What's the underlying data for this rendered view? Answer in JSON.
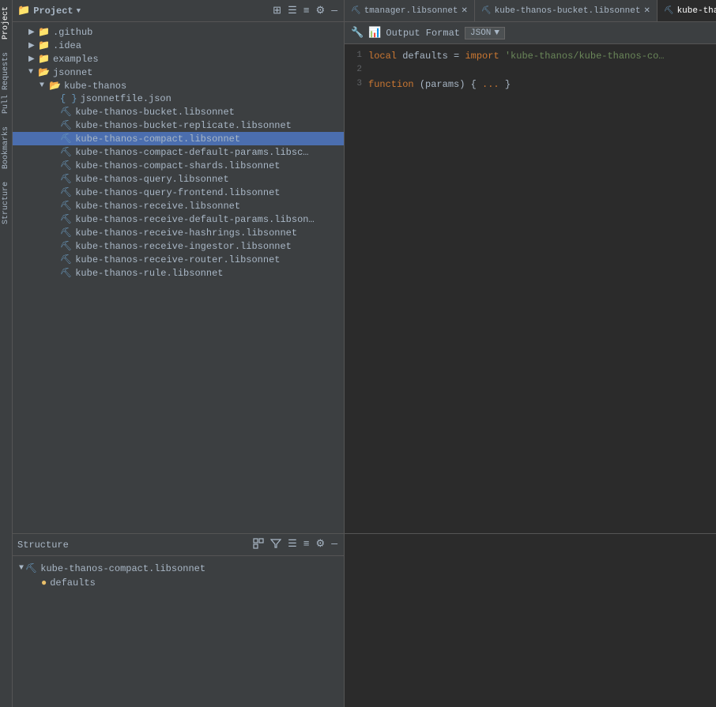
{
  "leftSidebar": {
    "tabs": [
      {
        "label": "Project",
        "active": true
      },
      {
        "label": "Pull Requests",
        "active": false
      },
      {
        "label": "Bookmarks",
        "active": false
      },
      {
        "label": "Structure",
        "active": false
      }
    ]
  },
  "projectPanel": {
    "title": "Project",
    "toolbar": {
      "icons": [
        "⊞",
        "☰",
        "≡",
        "⚙",
        "—"
      ]
    },
    "tree": [
      {
        "id": "github",
        "label": ".github",
        "indent": 1,
        "type": "folder",
        "arrow": "▶",
        "expanded": false
      },
      {
        "id": "idea",
        "label": ".idea",
        "indent": 1,
        "type": "folder",
        "arrow": "▶",
        "expanded": false
      },
      {
        "id": "examples",
        "label": "examples",
        "indent": 1,
        "type": "folder",
        "arrow": "▶",
        "expanded": false
      },
      {
        "id": "jsonnet",
        "label": "jsonnet",
        "indent": 1,
        "type": "folder",
        "arrow": "▼",
        "expanded": true
      },
      {
        "id": "kube-thanos",
        "label": "kube-thanos",
        "indent": 2,
        "type": "folder",
        "arrow": "▼",
        "expanded": true
      },
      {
        "id": "jsonnetfile.json",
        "label": "jsonnetfile.json",
        "indent": 3,
        "type": "json",
        "arrow": ""
      },
      {
        "id": "kube-thanos-bucket.libsonnet",
        "label": "kube-thanos-bucket.libsonnet",
        "indent": 3,
        "type": "libsonnet",
        "arrow": ""
      },
      {
        "id": "kube-thanos-bucket-replicate.libsonnet",
        "label": "kube-thanos-bucket-replicate.libsonnet",
        "indent": 3,
        "type": "libsonnet",
        "arrow": ""
      },
      {
        "id": "kube-thanos-compact.libsonnet",
        "label": "kube-thanos-compact.libsonnet",
        "indent": 3,
        "type": "libsonnet",
        "arrow": "",
        "selected": true
      },
      {
        "id": "kube-thanos-compact-default-params.libsonnet",
        "label": "kube-thanos-compact-default-params.libsc…",
        "indent": 3,
        "type": "libsonnet",
        "arrow": ""
      },
      {
        "id": "kube-thanos-compact-shards.libsonnet",
        "label": "kube-thanos-compact-shards.libsonnet",
        "indent": 3,
        "type": "libsonnet",
        "arrow": ""
      },
      {
        "id": "kube-thanos-query.libsonnet",
        "label": "kube-thanos-query.libsonnet",
        "indent": 3,
        "type": "libsonnet",
        "arrow": ""
      },
      {
        "id": "kube-thanos-query-frontend.libsonnet",
        "label": "kube-thanos-query-frontend.libsonnet",
        "indent": 3,
        "type": "libsonnet",
        "arrow": ""
      },
      {
        "id": "kube-thanos-receive.libsonnet",
        "label": "kube-thanos-receive.libsonnet",
        "indent": 3,
        "type": "libsonnet",
        "arrow": ""
      },
      {
        "id": "kube-thanos-receive-default-params.libsonnet",
        "label": "kube-thanos-receive-default-params.libson…",
        "indent": 3,
        "type": "libsonnet",
        "arrow": ""
      },
      {
        "id": "kube-thanos-receive-hashrings.libsonnet",
        "label": "kube-thanos-receive-hashrings.libsonnet",
        "indent": 3,
        "type": "libsonnet",
        "arrow": ""
      },
      {
        "id": "kube-thanos-receive-ingestor.libsonnet",
        "label": "kube-thanos-receive-ingestor.libsonnet",
        "indent": 3,
        "type": "libsonnet",
        "arrow": ""
      },
      {
        "id": "kube-thanos-receive-router.libsonnet",
        "label": "kube-thanos-receive-router.libsonnet",
        "indent": 3,
        "type": "libsonnet",
        "arrow": ""
      },
      {
        "id": "kube-thanos-rule.libsonnet",
        "label": "kube-thanos-rule.libsonnet",
        "indent": 3,
        "type": "libsonnet",
        "arrow": ""
      }
    ]
  },
  "editor": {
    "tabs": [
      {
        "id": "tmanager",
        "label": "tmanager.libsonnet",
        "active": false,
        "closeable": true
      },
      {
        "id": "kube-thanos-bucket",
        "label": "kube-thanos-bucket.libsonnet",
        "active": false,
        "closeable": true
      },
      {
        "id": "kube-thanos-compact",
        "label": "kube-tha…",
        "active": true,
        "closeable": true
      }
    ],
    "toolbar": {
      "wrench_icon": "🔧",
      "bar_icon": "📊",
      "output_format_label": "Output Format",
      "format_value": "JSON",
      "dropdown_arrow": "▼"
    },
    "code": [
      {
        "line": 1,
        "content": "local defaults = import 'kube-thanos/kube-thanos-co…"
      },
      {
        "line": 2,
        "content": ""
      },
      {
        "line": 3,
        "content": "function(params) {...}"
      }
    ]
  },
  "structurePanel": {
    "title": "Structure",
    "toolbar": {
      "icons": [
        "☰",
        "≡",
        "⚙",
        "—"
      ]
    },
    "items": [
      {
        "id": "kube-thanos-compact",
        "label": "kube-thanos-compact.libsonnet",
        "type": "libsonnet",
        "expanded": true,
        "children": [
          {
            "id": "defaults",
            "label": "defaults",
            "type": "orange"
          }
        ]
      }
    ]
  },
  "colors": {
    "bg": "#2b2b2b",
    "panel": "#3c3f41",
    "selected": "#4b6eaf",
    "border": "#555555",
    "text": "#a9b7c6",
    "keyword": "#cc7832",
    "string": "#6a8759",
    "lineNumber": "#606366"
  }
}
